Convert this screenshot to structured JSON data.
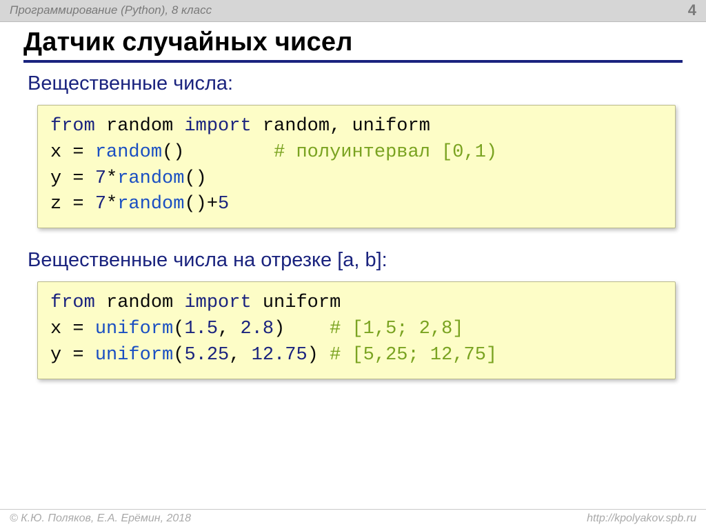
{
  "header": {
    "course": "Программирование (Python), 8 класс",
    "page_number": "4"
  },
  "title": "Датчик случайных чисел",
  "section1": {
    "heading": "Вещественные числа:",
    "code": {
      "l1_from": "from",
      "l1_mod": " random ",
      "l1_import": "import",
      "l1_rest": " random, uniform",
      "l2_pre": "x = ",
      "l2_fn": "random",
      "l2_post": "()        ",
      "l2_cmt": "# полуинтервал [0,1)",
      "l3_pre": "y = ",
      "l3_num": "7",
      "l3_mid": "*",
      "l3_fn": "random",
      "l3_post": "()",
      "l4_pre": "z = ",
      "l4_num1": "7",
      "l4_mid": "*",
      "l4_fn": "random",
      "l4_post": "()+",
      "l4_num2": "5"
    }
  },
  "section2": {
    "heading": "Вещественные числа на отрезке [a, b]:",
    "code": {
      "l1_from": "from",
      "l1_mod": " random ",
      "l1_import": "import",
      "l1_rest": " uniform",
      "l2_pre": "x = ",
      "l2_fn": "uniform",
      "l2_args_open": "(",
      "l2_a1": "1.5",
      "l2_sep": ", ",
      "l2_a2": "2.8",
      "l2_args_close": ")    ",
      "l2_cmt": "# [1,5; 2,8]",
      "l3_pre": "y = ",
      "l3_fn": "uniform",
      "l3_args_open": "(",
      "l3_a1": "5.25",
      "l3_sep": ", ",
      "l3_a2": "12.75",
      "l3_args_close": ") ",
      "l3_cmt": "# [5,25; 12,75]"
    }
  },
  "footer": {
    "credit": "© К.Ю. Поляков, Е.А. Ерёмин, 2018",
    "url": "http://kpolyakov.spb.ru"
  }
}
